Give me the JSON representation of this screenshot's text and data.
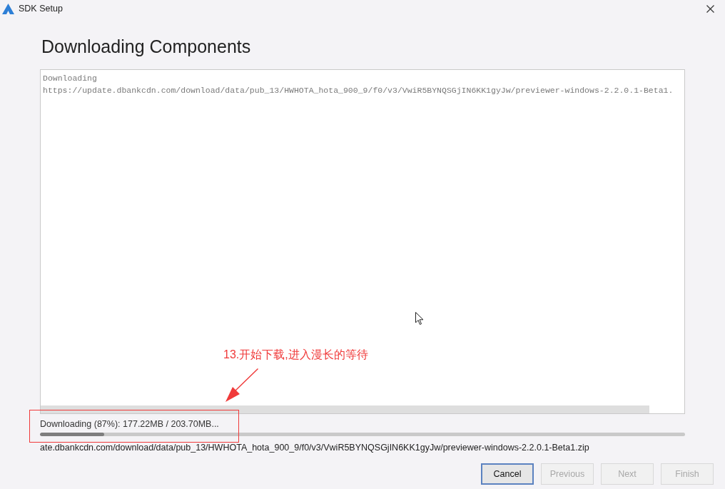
{
  "window": {
    "title": "SDK Setup"
  },
  "heading": "Downloading Components",
  "log": {
    "lines": [
      "Downloading",
      "https://update.dbankcdn.com/download/data/pub_13/HWHOTA_hota_900_9/f0/v3/VwiR5BYNQSGjIN6KK1gyJw/previewer-windows-2.2.0.1-Beta1."
    ]
  },
  "status": {
    "text": "Downloading (87%): 177.22MB / 203.70MB...",
    "level": 0.1
  },
  "current_file": "ate.dbankcdn.com/download/data/pub_13/HWHOTA_hota_900_9/f0/v3/VwiR5BYNQSGjIN6KK1gyJw/previewer-windows-2.2.0.1-Beta1.zip",
  "buttons": [
    {
      "label": "Cancel",
      "disabled": false,
      "focused": true
    },
    {
      "label": "Previous",
      "disabled": true,
      "focused": false
    },
    {
      "label": "Next",
      "disabled": true,
      "focused": false
    },
    {
      "label": "Finish",
      "disabled": true,
      "focused": false
    }
  ],
  "annotation": {
    "text": "13.开始下载,进入漫长的等待"
  }
}
